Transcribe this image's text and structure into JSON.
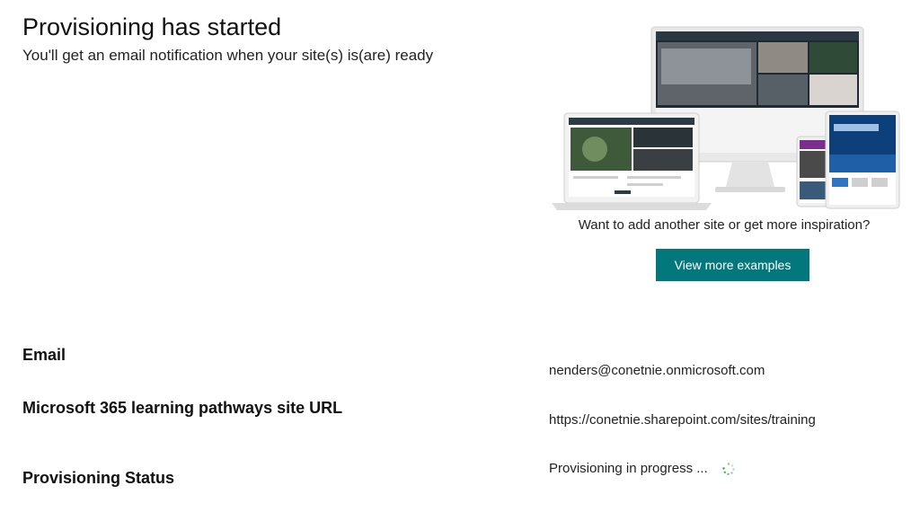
{
  "header": {
    "title": "Provisioning has started",
    "subtitle": "You'll get an email notification when your site(s) is(are) ready"
  },
  "promo": {
    "image_alt": "SharePoint site examples on monitor, laptop, tablet and phone",
    "caption": "Want to add another site or get more inspiration?",
    "button_label": "View more examples",
    "accent_color": "#03787c"
  },
  "details": {
    "email_label": "Email",
    "email_value": "nenders@conetnie.onmicrosoft.com",
    "site_label": "Microsoft 365 learning pathways site URL",
    "site_value": "https://conetnie.sharepoint.com/sites/training",
    "status_label": "Provisioning Status",
    "status_value": "Provisioning in progress ...",
    "status_icon": "spinner-icon"
  }
}
